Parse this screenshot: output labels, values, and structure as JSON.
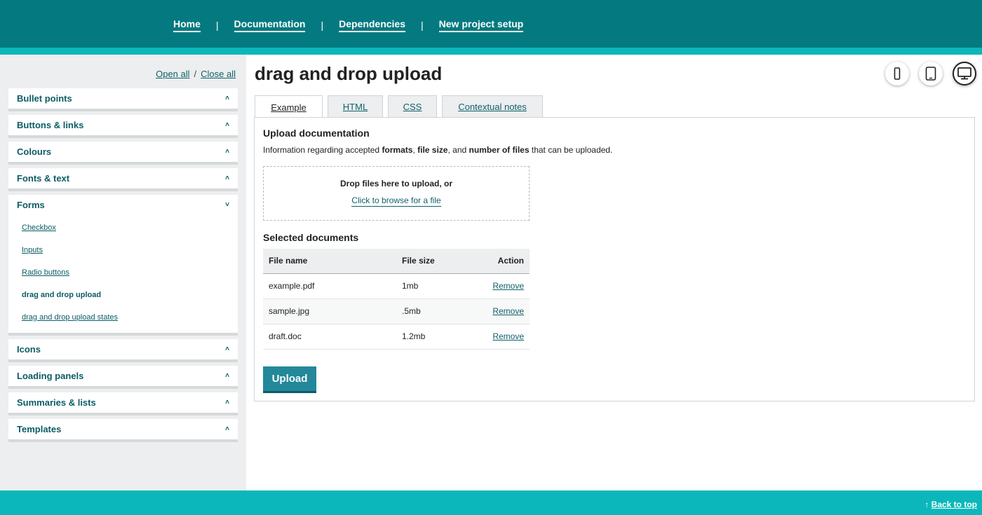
{
  "nav": {
    "items": [
      "Home",
      "Documentation",
      "Dependencies",
      "New project setup"
    ],
    "separator": "|"
  },
  "sidebar": {
    "open_all": "Open all",
    "slash": "/",
    "close_all": "Close all",
    "sections": [
      {
        "label": "Bullet points",
        "chevron": "˄"
      },
      {
        "label": "Buttons & links",
        "chevron": "˄"
      },
      {
        "label": "Colours",
        "chevron": "˄"
      },
      {
        "label": "Fonts & text",
        "chevron": "˄"
      },
      {
        "label": "Forms",
        "chevron": "˅",
        "expanded": true,
        "items": [
          "Checkbox",
          "Inputs",
          "Radio buttons",
          "drag and drop upload",
          "drag and drop upload states"
        ],
        "active_item": "drag and drop upload"
      },
      {
        "label": "Icons",
        "chevron": "˄"
      },
      {
        "label": "Loading panels",
        "chevron": "˄"
      },
      {
        "label": "Summaries & lists",
        "chevron": "˄"
      },
      {
        "label": "Templates",
        "chevron": "˄"
      }
    ]
  },
  "main": {
    "title": "drag and drop upload",
    "device_icons": [
      "mobile-icon",
      "tablet-icon",
      "desktop-icon"
    ],
    "active_device": "desktop-icon",
    "tabs": [
      {
        "label": "Example",
        "active": true
      },
      {
        "label": "HTML"
      },
      {
        "label": "CSS"
      },
      {
        "label": "Contextual notes"
      }
    ],
    "panel": {
      "heading": "Upload documentation",
      "info": {
        "pre": "Information regarding accepted ",
        "b1": "formats",
        "mid1": ", ",
        "b2": "file size",
        "mid2": ", and ",
        "b3": "number of files",
        "post": " that can be uploaded."
      },
      "dropzone": {
        "text": "Drop files here to upload, or",
        "link": "Click to browse for a file"
      },
      "selected_heading": "Selected documents",
      "table": {
        "headers": [
          "File name",
          "File size",
          "Action"
        ],
        "rows": [
          {
            "name": "example.pdf",
            "size": "1mb",
            "action": "Remove"
          },
          {
            "name": "sample.jpg",
            "size": ".5mb",
            "action": "Remove"
          },
          {
            "name": "draft.doc",
            "size": "1.2mb",
            "action": "Remove"
          }
        ]
      },
      "upload_label": "Upload"
    }
  },
  "footer": {
    "arrow": "↑",
    "back_to_top": "Back to top"
  },
  "colors": {
    "header": "#047a80",
    "accent": "#0bb7ba",
    "link": "#10616a",
    "button": "#23889a"
  }
}
